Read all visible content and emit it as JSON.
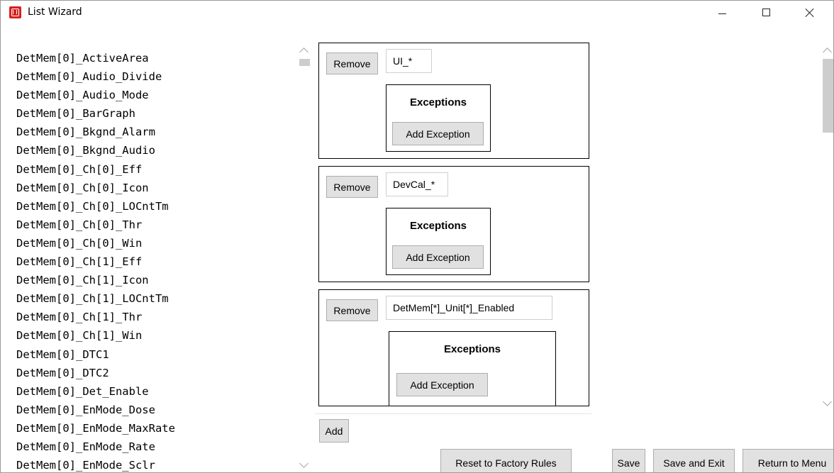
{
  "window": {
    "title": "List Wizard",
    "app_icon": "app-logo-icon",
    "controls": [
      "minimize-icon",
      "maximize-icon",
      "close-icon"
    ]
  },
  "variables": [
    "DetMem[0]_ActiveArea",
    "DetMem[0]_Audio_Divide",
    "DetMem[0]_Audio_Mode",
    "DetMem[0]_BarGraph",
    "DetMem[0]_Bkgnd_Alarm",
    "DetMem[0]_Bkgnd_Audio",
    "DetMem[0]_Ch[0]_Eff",
    "DetMem[0]_Ch[0]_Icon",
    "DetMem[0]_Ch[0]_LOCntTm",
    "DetMem[0]_Ch[0]_Thr",
    "DetMem[0]_Ch[0]_Win",
    "DetMem[0]_Ch[1]_Eff",
    "DetMem[0]_Ch[1]_Icon",
    "DetMem[0]_Ch[1]_LOCntTm",
    "DetMem[0]_Ch[1]_Thr",
    "DetMem[0]_Ch[1]_Win",
    "DetMem[0]_DTC1",
    "DetMem[0]_DTC2",
    "DetMem[0]_Det_Enable",
    "DetMem[0]_EnMode_Dose",
    "DetMem[0]_EnMode_MaxRate",
    "DetMem[0]_EnMode_Rate",
    "DetMem[0]_EnMode_Sclr"
  ],
  "rules": [
    {
      "remove_label": "Remove",
      "pattern": "UI_*",
      "exceptions_title": "Exceptions",
      "add_exception_label": "Add Exception"
    },
    {
      "remove_label": "Remove",
      "pattern": "DevCal_*",
      "exceptions_title": "Exceptions",
      "add_exception_label": "Add Exception"
    },
    {
      "remove_label": "Remove",
      "pattern": "DetMem[*]_Unit[*]_Enabled",
      "exceptions_title": "Exceptions",
      "add_exception_label": "Add Exception"
    }
  ],
  "buttons": {
    "add": "Add",
    "reset": "Reset to Factory Rules",
    "save": "Save",
    "save_and_exit": "Save and Exit",
    "return_to_menu": "Return to Menu"
  }
}
